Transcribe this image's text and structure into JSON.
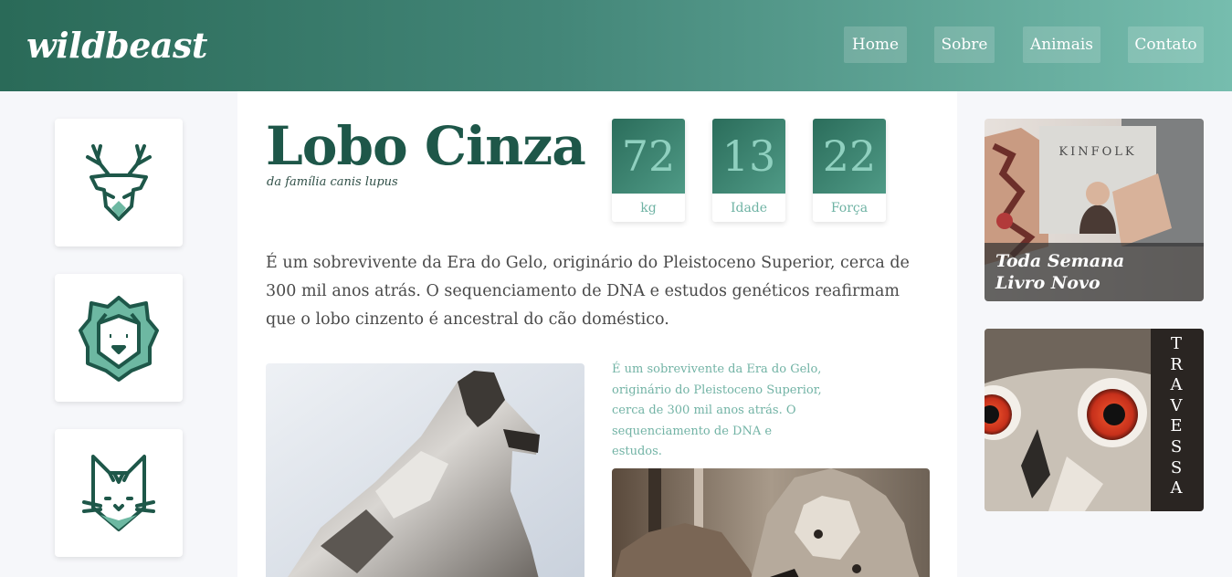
{
  "header": {
    "logo": "wildbeast",
    "nav": [
      "Home",
      "Sobre",
      "Animais",
      "Contato"
    ]
  },
  "sidebar": {
    "items": [
      {
        "icon": "deer-icon"
      },
      {
        "icon": "lion-icon"
      },
      {
        "icon": "cat-icon"
      }
    ]
  },
  "main": {
    "title": "Lobo Cinza",
    "subtitle": "da família canis lupus",
    "stats": [
      {
        "value": "72",
        "label": "kg"
      },
      {
        "value": "13",
        "label": "Idade"
      },
      {
        "value": "22",
        "label": "Força"
      }
    ],
    "lead": "É um sobrevivente da Era do Gelo, originário do Pleistoceno Superior, cerca de 300 mil anos atrás. O sequenciamento de DNA e estudos genéticos reafirmam que o lobo cinzento é ancestral do cão doméstico.",
    "side_text": "É um sobrevivente da Era do Gelo, originário do Pleistoceno Superior, cerca de 300 mil anos atrás. O sequenciamento de DNA e estudos."
  },
  "aside": {
    "promo1": {
      "line1": "Toda Semana",
      "line2": "Livro Novo",
      "magazine": "KINFOLK"
    },
    "promo2": {
      "vertical_text": [
        "T",
        "R",
        "A",
        "V",
        "E",
        "S",
        "S",
        "A"
      ]
    }
  },
  "colors": {
    "header_start": "#2a6a58",
    "header_end": "#76bdae",
    "title": "#1e5749",
    "accent": "#72b3a5"
  }
}
